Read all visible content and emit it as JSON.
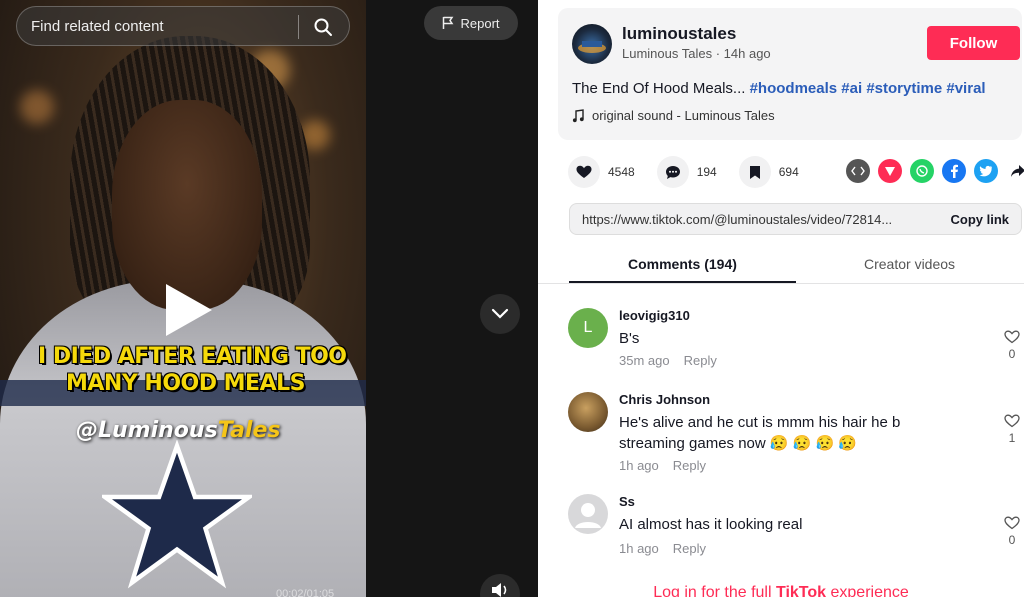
{
  "search": {
    "placeholder": "Find related content"
  },
  "report": {
    "label": "Report"
  },
  "video": {
    "caption_line1": "I DIED AFTER EATING TOO",
    "caption_line2": "MANY HOOD MEALS",
    "watermark_at": "@Luminous",
    "watermark_tail": "Tales",
    "timecode": "00:02/01:05"
  },
  "author": {
    "username": "luminoustales",
    "display_name": "Luminous Tales",
    "posted": "14h ago",
    "follow_label": "Follow"
  },
  "post": {
    "description_text": "The End Of Hood Meals...",
    "hashtags": [
      "#hoodmeals",
      "#ai",
      "#storytime",
      "#viral"
    ],
    "sound": "original sound - Luminous Tales"
  },
  "stats": {
    "likes": "4548",
    "comments": "194",
    "saves": "694"
  },
  "share_icons": [
    "embed-icon",
    "tiktok-share-icon",
    "whatsapp-icon",
    "facebook-icon",
    "twitter-icon",
    "share-arrow-icon"
  ],
  "link": {
    "url": "https://www.tiktok.com/@luminoustales/video/72814...",
    "copy_label": "Copy link"
  },
  "tabs": {
    "comments": "Comments (194)",
    "creator": "Creator videos"
  },
  "comments": [
    {
      "user": "leovigig310",
      "initial": "L",
      "avatar_color": "#6ab04c",
      "text": "B's",
      "time": "35m ago",
      "reply": "Reply",
      "likes": "0"
    },
    {
      "user": "Chris Johnson",
      "initial": "",
      "avatar_color": "#8a6a3a",
      "text": "He's alive and he cut is mmm his hair he b streaming games now 😥 😥 😥 😥",
      "time": "1h ago",
      "reply": "Reply",
      "likes": "1"
    },
    {
      "user": "Ss",
      "initial": "",
      "avatar_color": "#d8d8da",
      "text": "AI almost has it looking real",
      "time": "1h ago",
      "reply": "Reply",
      "likes": "0"
    }
  ],
  "login_banner": {
    "prefix": "Log in for the full ",
    "brand": "TikTok",
    "suffix": " experience"
  },
  "colors": {
    "accent": "#fe2c55",
    "hashtag": "#2b5db9",
    "caption": "#f5d90a"
  }
}
